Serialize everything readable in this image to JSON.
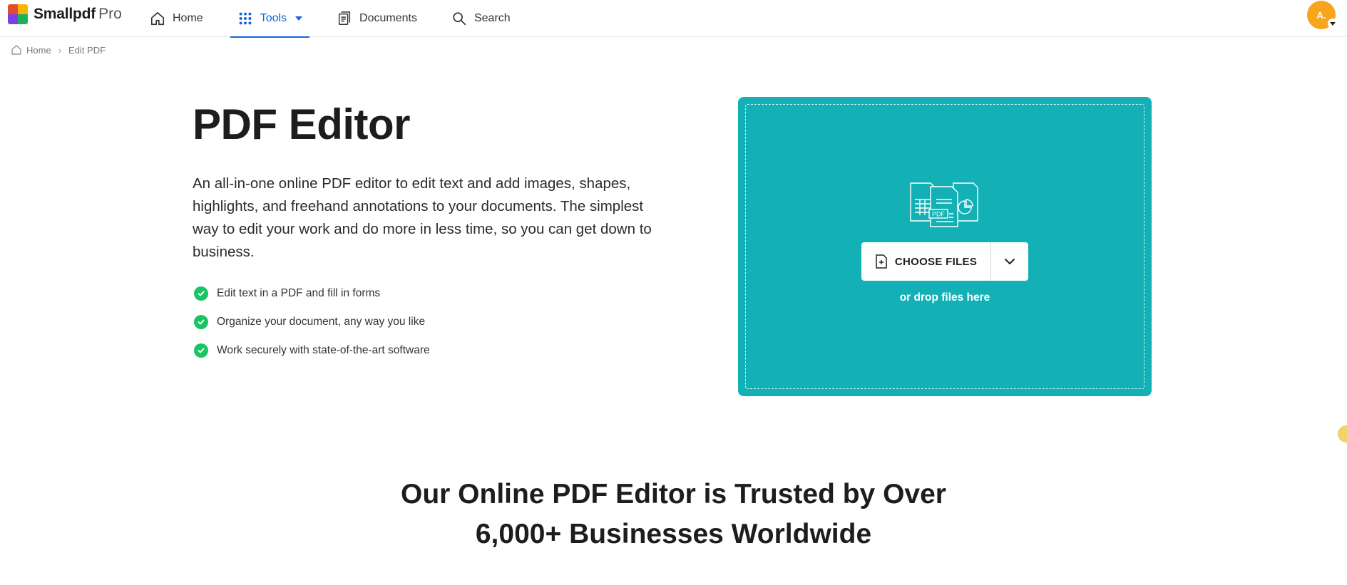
{
  "brand": {
    "name": "Smallpdf",
    "tier": "Pro"
  },
  "nav": {
    "home": "Home",
    "tools": "Tools",
    "documents": "Documents",
    "search": "Search"
  },
  "user": {
    "initials": "A."
  },
  "breadcrumb": {
    "home": "Home",
    "current": "Edit PDF"
  },
  "hero": {
    "title": "PDF Editor",
    "description": "An all-in-one online PDF editor to edit text and add images, shapes, highlights, and freehand annotations to your documents. The simplest way to edit your work and do more in less time, so you can get down to business.",
    "features": [
      "Edit text in a PDF and fill in forms",
      "Organize your document, any way you like",
      "Work securely with state-of-the-art software"
    ]
  },
  "upload": {
    "choose_label": "CHOOSE FILES",
    "drop_hint": "or drop files here",
    "illustration_label": "PDF",
    "bg_color": "#13b0b5"
  },
  "trust": {
    "line1": "Our Online PDF Editor is Trusted by Over",
    "line2": "6,000+ Businesses Worldwide"
  },
  "colors": {
    "accent": "#1565d8",
    "check": "#19c463",
    "avatar": "#f7a51c"
  }
}
